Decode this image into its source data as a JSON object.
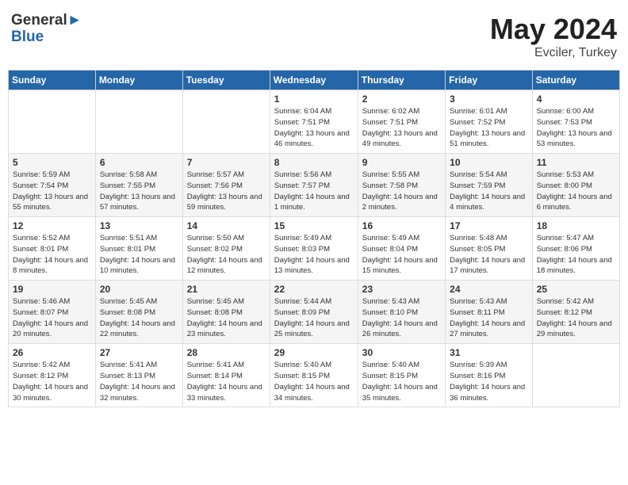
{
  "header": {
    "logo_general": "General",
    "logo_blue": "Blue",
    "month_year": "May 2024",
    "location": "Evciler, Turkey"
  },
  "weekdays": [
    "Sunday",
    "Monday",
    "Tuesday",
    "Wednesday",
    "Thursday",
    "Friday",
    "Saturday"
  ],
  "weeks": [
    [
      {
        "day": "",
        "sunrise": "",
        "sunset": "",
        "daylight": ""
      },
      {
        "day": "",
        "sunrise": "",
        "sunset": "",
        "daylight": ""
      },
      {
        "day": "",
        "sunrise": "",
        "sunset": "",
        "daylight": ""
      },
      {
        "day": "1",
        "sunrise": "Sunrise: 6:04 AM",
        "sunset": "Sunset: 7:51 PM",
        "daylight": "Daylight: 13 hours and 46 minutes."
      },
      {
        "day": "2",
        "sunrise": "Sunrise: 6:02 AM",
        "sunset": "Sunset: 7:51 PM",
        "daylight": "Daylight: 13 hours and 49 minutes."
      },
      {
        "day": "3",
        "sunrise": "Sunrise: 6:01 AM",
        "sunset": "Sunset: 7:52 PM",
        "daylight": "Daylight: 13 hours and 51 minutes."
      },
      {
        "day": "4",
        "sunrise": "Sunrise: 6:00 AM",
        "sunset": "Sunset: 7:53 PM",
        "daylight": "Daylight: 13 hours and 53 minutes."
      }
    ],
    [
      {
        "day": "5",
        "sunrise": "Sunrise: 5:59 AM",
        "sunset": "Sunset: 7:54 PM",
        "daylight": "Daylight: 13 hours and 55 minutes."
      },
      {
        "day": "6",
        "sunrise": "Sunrise: 5:58 AM",
        "sunset": "Sunset: 7:55 PM",
        "daylight": "Daylight: 13 hours and 57 minutes."
      },
      {
        "day": "7",
        "sunrise": "Sunrise: 5:57 AM",
        "sunset": "Sunset: 7:56 PM",
        "daylight": "Daylight: 13 hours and 59 minutes."
      },
      {
        "day": "8",
        "sunrise": "Sunrise: 5:56 AM",
        "sunset": "Sunset: 7:57 PM",
        "daylight": "Daylight: 14 hours and 1 minute."
      },
      {
        "day": "9",
        "sunrise": "Sunrise: 5:55 AM",
        "sunset": "Sunset: 7:58 PM",
        "daylight": "Daylight: 14 hours and 2 minutes."
      },
      {
        "day": "10",
        "sunrise": "Sunrise: 5:54 AM",
        "sunset": "Sunset: 7:59 PM",
        "daylight": "Daylight: 14 hours and 4 minutes."
      },
      {
        "day": "11",
        "sunrise": "Sunrise: 5:53 AM",
        "sunset": "Sunset: 8:00 PM",
        "daylight": "Daylight: 14 hours and 6 minutes."
      }
    ],
    [
      {
        "day": "12",
        "sunrise": "Sunrise: 5:52 AM",
        "sunset": "Sunset: 8:01 PM",
        "daylight": "Daylight: 14 hours and 8 minutes."
      },
      {
        "day": "13",
        "sunrise": "Sunrise: 5:51 AM",
        "sunset": "Sunset: 8:01 PM",
        "daylight": "Daylight: 14 hours and 10 minutes."
      },
      {
        "day": "14",
        "sunrise": "Sunrise: 5:50 AM",
        "sunset": "Sunset: 8:02 PM",
        "daylight": "Daylight: 14 hours and 12 minutes."
      },
      {
        "day": "15",
        "sunrise": "Sunrise: 5:49 AM",
        "sunset": "Sunset: 8:03 PM",
        "daylight": "Daylight: 14 hours and 13 minutes."
      },
      {
        "day": "16",
        "sunrise": "Sunrise: 5:49 AM",
        "sunset": "Sunset: 8:04 PM",
        "daylight": "Daylight: 14 hours and 15 minutes."
      },
      {
        "day": "17",
        "sunrise": "Sunrise: 5:48 AM",
        "sunset": "Sunset: 8:05 PM",
        "daylight": "Daylight: 14 hours and 17 minutes."
      },
      {
        "day": "18",
        "sunrise": "Sunrise: 5:47 AM",
        "sunset": "Sunset: 8:06 PM",
        "daylight": "Daylight: 14 hours and 18 minutes."
      }
    ],
    [
      {
        "day": "19",
        "sunrise": "Sunrise: 5:46 AM",
        "sunset": "Sunset: 8:07 PM",
        "daylight": "Daylight: 14 hours and 20 minutes."
      },
      {
        "day": "20",
        "sunrise": "Sunrise: 5:45 AM",
        "sunset": "Sunset: 8:08 PM",
        "daylight": "Daylight: 14 hours and 22 minutes."
      },
      {
        "day": "21",
        "sunrise": "Sunrise: 5:45 AM",
        "sunset": "Sunset: 8:08 PM",
        "daylight": "Daylight: 14 hours and 23 minutes."
      },
      {
        "day": "22",
        "sunrise": "Sunrise: 5:44 AM",
        "sunset": "Sunset: 8:09 PM",
        "daylight": "Daylight: 14 hours and 25 minutes."
      },
      {
        "day": "23",
        "sunrise": "Sunrise: 5:43 AM",
        "sunset": "Sunset: 8:10 PM",
        "daylight": "Daylight: 14 hours and 26 minutes."
      },
      {
        "day": "24",
        "sunrise": "Sunrise: 5:43 AM",
        "sunset": "Sunset: 8:11 PM",
        "daylight": "Daylight: 14 hours and 27 minutes."
      },
      {
        "day": "25",
        "sunrise": "Sunrise: 5:42 AM",
        "sunset": "Sunset: 8:12 PM",
        "daylight": "Daylight: 14 hours and 29 minutes."
      }
    ],
    [
      {
        "day": "26",
        "sunrise": "Sunrise: 5:42 AM",
        "sunset": "Sunset: 8:12 PM",
        "daylight": "Daylight: 14 hours and 30 minutes."
      },
      {
        "day": "27",
        "sunrise": "Sunrise: 5:41 AM",
        "sunset": "Sunset: 8:13 PM",
        "daylight": "Daylight: 14 hours and 32 minutes."
      },
      {
        "day": "28",
        "sunrise": "Sunrise: 5:41 AM",
        "sunset": "Sunset: 8:14 PM",
        "daylight": "Daylight: 14 hours and 33 minutes."
      },
      {
        "day": "29",
        "sunrise": "Sunrise: 5:40 AM",
        "sunset": "Sunset: 8:15 PM",
        "daylight": "Daylight: 14 hours and 34 minutes."
      },
      {
        "day": "30",
        "sunrise": "Sunrise: 5:40 AM",
        "sunset": "Sunset: 8:15 PM",
        "daylight": "Daylight: 14 hours and 35 minutes."
      },
      {
        "day": "31",
        "sunrise": "Sunrise: 5:39 AM",
        "sunset": "Sunset: 8:16 PM",
        "daylight": "Daylight: 14 hours and 36 minutes."
      },
      {
        "day": "",
        "sunrise": "",
        "sunset": "",
        "daylight": ""
      }
    ]
  ]
}
